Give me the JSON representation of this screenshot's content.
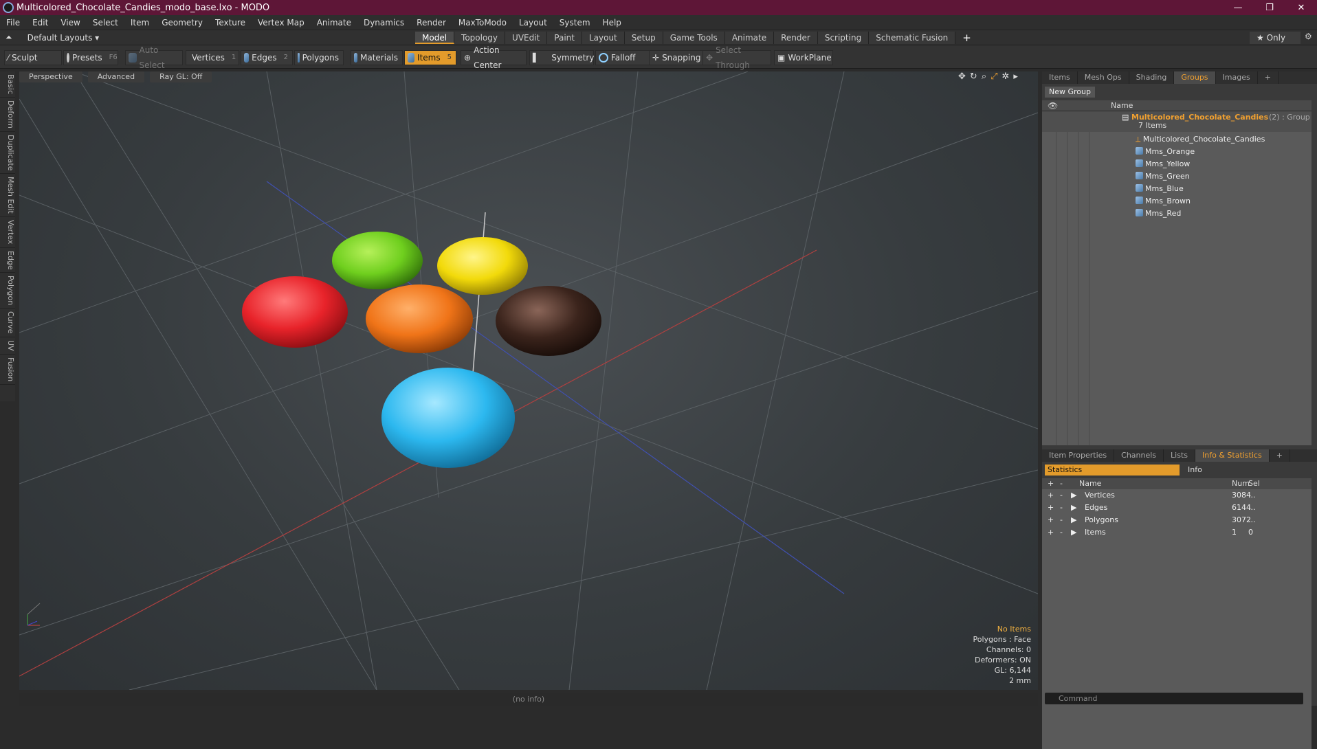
{
  "window": {
    "title": "Multicolored_Chocolate_Candies_modo_base.lxo - MODO",
    "min": "—",
    "max": "❐",
    "close": "✕"
  },
  "menu": [
    "File",
    "Edit",
    "View",
    "Select",
    "Item",
    "Geometry",
    "Texture",
    "Vertex Map",
    "Animate",
    "Dynamics",
    "Render",
    "MaxToModo",
    "Layout",
    "System",
    "Help"
  ],
  "layout": {
    "selector": "Default Layouts ▾",
    "tabs": [
      "Model",
      "Topology",
      "UVEdit",
      "Paint",
      "Layout",
      "Setup",
      "Game Tools",
      "Animate",
      "Render",
      "Scripting",
      "Schematic Fusion"
    ],
    "active": "Model",
    "plus": "+",
    "only": "★ Only"
  },
  "toolbar": {
    "sculpt": "Sculpt",
    "presets": "Presets",
    "presets_key": "F6",
    "auto_select": "Auto Select",
    "vertices": "Vertices",
    "vertices_n": "1",
    "edges": "Edges",
    "edges_n": "2",
    "polygons": "Polygons",
    "materials": "Materials",
    "items": "Items",
    "items_n": "5",
    "action_center": "Action Center",
    "symmetry": "Symmetry",
    "falloff": "Falloff",
    "snapping": "Snapping",
    "select_through": "Select Through",
    "workplane": "WorkPlane"
  },
  "left_tabs": [
    "Basic",
    "Deform",
    "Duplicate",
    "Mesh Edit",
    "Vertex",
    "Edge",
    "Polygon",
    "Curve",
    "UV",
    "Fusion"
  ],
  "viewport": {
    "view": "Perspective",
    "shading": "Advanced",
    "raygl": "Ray GL: Off",
    "info": {
      "items": "No Items",
      "polygons": "Polygons : Face",
      "channels": "Channels: 0",
      "deformers": "Deformers: ON",
      "gl": "GL: 6,144",
      "scale": "2 mm"
    },
    "colors": {
      "red": "#e8232a",
      "green": "#6fcf1e",
      "yellow": "#f2da0a",
      "orange": "#f07418",
      "brown": "#3b241c",
      "blue": "#2cb8ef"
    }
  },
  "status": "(no info)",
  "right_top": {
    "tabs": [
      "Items",
      "Mesh Ops",
      "Shading",
      "Groups",
      "Images"
    ],
    "active": "Groups",
    "new_group": "New Group",
    "col_name": "Name",
    "group": {
      "name": "Multicolored_Chocolate_Candies",
      "suffix": "(2) : Group",
      "count": "7 Items"
    },
    "children": [
      "Multicolored_Chocolate_Candies",
      "Mms_Orange",
      "Mms_Yellow",
      "Mms_Green",
      "Mms_Blue",
      "Mms_Brown",
      "Mms_Red"
    ]
  },
  "right_bottom": {
    "tabs": [
      "Item Properties",
      "Channels",
      "Lists",
      "Info & Statistics"
    ],
    "active": "Info & Statistics",
    "statistics": "Statistics",
    "info": "Info",
    "cols": {
      "name": "Name",
      "num": "Num",
      "sel": "Sel"
    },
    "rows": [
      {
        "name": "Vertices",
        "num": "3084",
        "sel": "..."
      },
      {
        "name": "Edges",
        "num": "6144",
        "sel": "..."
      },
      {
        "name": "Polygons",
        "num": "3072",
        "sel": "..."
      },
      {
        "name": "Items",
        "num": "1",
        "sel": "0"
      }
    ]
  },
  "command": {
    "placeholder": "Command"
  }
}
